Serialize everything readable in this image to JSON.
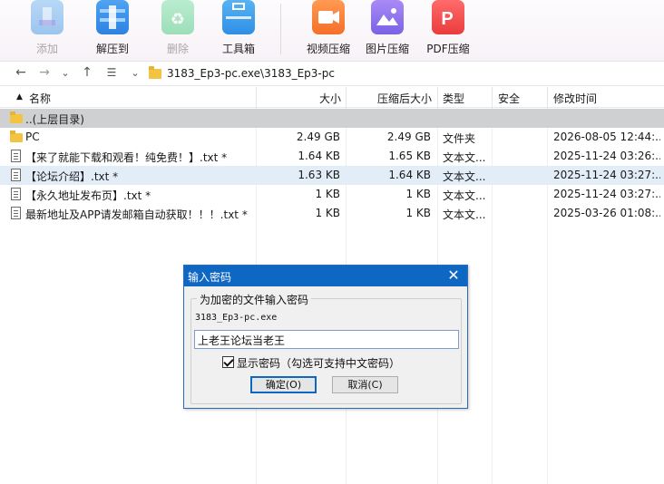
{
  "toolbar": {
    "items": [
      {
        "label": "添加",
        "icon": "add-archive-icon",
        "enabled": false
      },
      {
        "label": "解压到",
        "icon": "extract-to-icon",
        "enabled": true
      },
      {
        "label": "删除",
        "icon": "recycle-bin-icon",
        "enabled": false
      },
      {
        "label": "工具箱",
        "icon": "toolbox-icon",
        "enabled": true
      },
      {
        "label": "视频压缩",
        "icon": "video-compress-icon",
        "enabled": true
      },
      {
        "label": "图片压缩",
        "icon": "image-compress-icon",
        "enabled": true
      },
      {
        "label": "PDF压缩",
        "icon": "pdf-compress-icon",
        "enabled": true
      }
    ]
  },
  "address": {
    "path": "3183_Ep3-pc.exe\\3183_Ep3-pc"
  },
  "columns": {
    "name": "名称",
    "size": "大小",
    "packed": "压缩后大小",
    "type": "类型",
    "security": "安全",
    "modified": "修改时间"
  },
  "rows": [
    {
      "name": "..(上层目录)",
      "size": "",
      "packed": "",
      "type": "",
      "modified": "",
      "kind": "folder"
    },
    {
      "name": "PC",
      "size": "2.49 GB",
      "packed": "2.49 GB",
      "type": "文件夹",
      "modified": "2026-08-05 12:44:...",
      "kind": "folder"
    },
    {
      "name": "【来了就能下载和观看！纯免费！】.txt *",
      "size": "1.64 KB",
      "packed": "1.65 KB",
      "type": "文本文...",
      "modified": "2025-11-24 03:26:...",
      "kind": "doc"
    },
    {
      "name": "【论坛介绍】.txt *",
      "size": "1.63 KB",
      "packed": "1.64 KB",
      "type": "文本文...",
      "modified": "2025-11-24 03:27:...",
      "kind": "doc"
    },
    {
      "name": "【永久地址发布页】.txt *",
      "size": "1 KB",
      "packed": "1 KB",
      "type": "文本文...",
      "modified": "2025-11-24 03:27:...",
      "kind": "doc"
    },
    {
      "name": "最新地址及APP请发邮箱自动获取！！！.txt *",
      "size": "1 KB",
      "packed": "1 KB",
      "type": "文本文...",
      "modified": "2025-03-26 01:08:...",
      "kind": "doc"
    }
  ],
  "dialog": {
    "title": "输入密码",
    "group_label": "为加密的文件输入密码",
    "filename": "3183_Ep3-pc.exe",
    "password_value": "上老王论坛当老王",
    "show_password_label": "显示密码（勾选可支持中文密码）",
    "show_password_checked": true,
    "ok_label": "确定(O)",
    "cancel_label": "取消(C)"
  },
  "colors": {
    "title_bar": "#0f67c4",
    "selected_row": "#e3edf8",
    "parent_row": "#cfd0d2"
  }
}
